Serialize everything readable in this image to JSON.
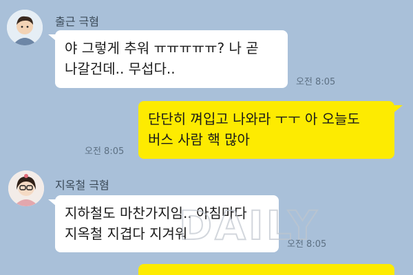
{
  "messages": [
    {
      "sender": "출근 극혐",
      "text": "야 그렇게 추워 ㅠㅠㅠㅠㅠ? 나 곧\n나갈건데.. 무섭다..",
      "time": "오전 8:05"
    },
    {
      "sender": "",
      "text": "단단히 껴입고 나와라 ㅜㅜ 아 오늘도\n버스 사람 핵 많아",
      "time": "오전 8:05"
    },
    {
      "sender": "지옥철 극혐",
      "text": "지하철도 마찬가지임.. 아침마다\n지옥철 지겹다 지겨워",
      "time": "오전 8:05"
    }
  ],
  "watermark": "DAILY",
  "colors": {
    "background": "#a9c0d9",
    "incoming": "#ffffff",
    "outgoing": "#fdeb01"
  }
}
